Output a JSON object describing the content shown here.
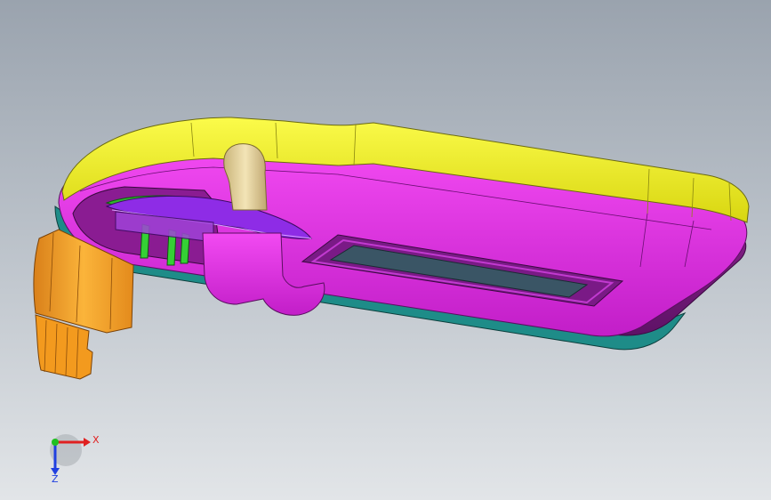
{
  "viewport": {
    "background_top": "#9aa3ae",
    "background_bottom": "#e2e5e8"
  },
  "model": {
    "colors": {
      "yellow": "#f0ef1e",
      "magenta": "#e82ee8",
      "dark_magenta": "#7d1a86",
      "teal": "#1a8a86",
      "orange": "#f2a020",
      "green": "#3cd23c",
      "purple": "#8a2be2",
      "tan": "#e8d6a0",
      "glass": "#3a5565"
    }
  },
  "triad": {
    "x_label": "X",
    "z_label": "Z",
    "x_color": "#e02020",
    "y_color": "#20c020",
    "z_color": "#2040e0"
  }
}
